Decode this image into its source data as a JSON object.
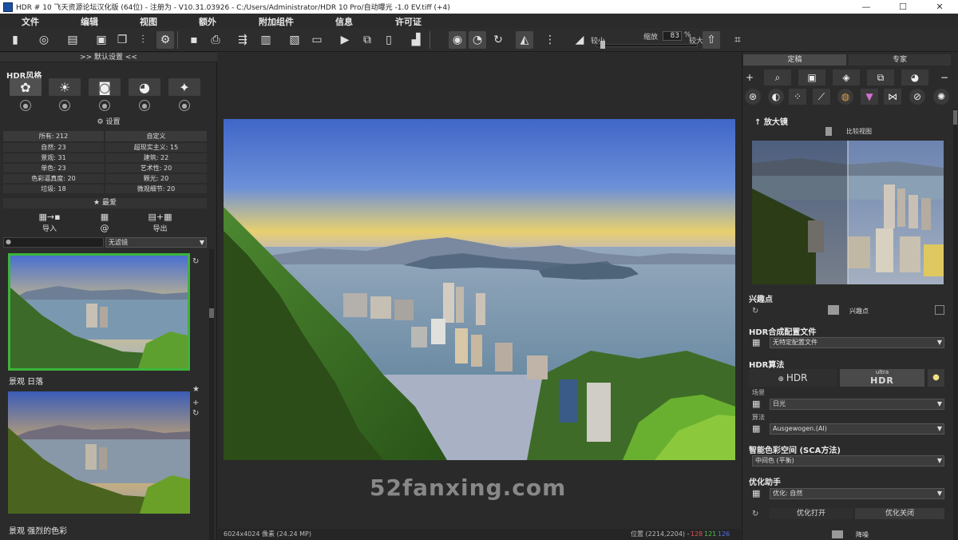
{
  "window": {
    "title": "HDR # 10 飞天资源论坛汉化版 (64位) - 注册为 - V10.31.03926 - C:/Users/Administrator/HDR 10 Pro/自动曝光 -1.0 EV.tiff (+4)",
    "minimize": "—",
    "maximize": "☐",
    "close": "✕"
  },
  "menu": [
    "文件",
    "编辑",
    "视图",
    "额外",
    "附加组件",
    "信息",
    "许可证"
  ],
  "toolbar": {
    "zoom_label": "缩放",
    "zoom_value": "83",
    "zoom_unit": "%",
    "zoom_small": "较小",
    "zoom_large": "较大"
  },
  "left": {
    "header": ">> 默认设置 <<",
    "hdr_style_title": "HDR风格",
    "settings": "设置",
    "categories": {
      "all": "所有: 212",
      "custom": "自定义",
      "rows": [
        [
          "自然: 23",
          "超现实主义: 15"
        ],
        [
          "景观: 31",
          "建筑: 22"
        ],
        [
          "单色: 23",
          "艺术性: 20"
        ],
        [
          "色彩逼真度: 20",
          "颗光: 20"
        ],
        [
          "垃圾: 18",
          "微观细节: 20"
        ]
      ]
    },
    "favorites": "最爱",
    "import": "导入",
    "export": "导出",
    "at_symbol": "@",
    "filter_select": "无滤镜",
    "thumbnails": [
      {
        "label": ""
      },
      {
        "label": "景观 日落"
      },
      {
        "label": "景观 强烈的色彩"
      }
    ]
  },
  "center": {
    "watermark": "52fanxing.com",
    "status_left": "6024x4024 像素 (24.24 MP)",
    "status_pos": "位置 (2214,2204) -",
    "status_r": "128",
    "status_g": "121",
    "status_b": "126"
  },
  "right": {
    "tabs": [
      "定稿",
      "专家"
    ],
    "magnifier": "放大镜",
    "compare_view": "比较视图",
    "poi_title": "兴趣点",
    "poi_label": "兴趣点",
    "profile_title": "HDR合成配置文件",
    "profile_value": "无特定配置文件",
    "algo_title": "HDR算法",
    "algo_hdr": "HDR",
    "algo_ultra": "ultra",
    "algo_ultra_hdr": "HDR",
    "scene_label": "场景",
    "scene_value": "日光",
    "method_label": "算法",
    "method_value": "Ausgewogen.(AI)",
    "sca_title": "智能色彩空间 (SCA方法)",
    "sca_value": "中间色 (平衡)",
    "opt_title": "优化助手",
    "opt_value": "优化: 自然",
    "opt_open": "优化打开",
    "opt_close": "优化关闭",
    "denoise": "降噪"
  },
  "colors": {
    "selected_border": "#3cb43c",
    "status_r": "#e05050",
    "status_g": "#50c050",
    "status_b": "#5070e0"
  }
}
